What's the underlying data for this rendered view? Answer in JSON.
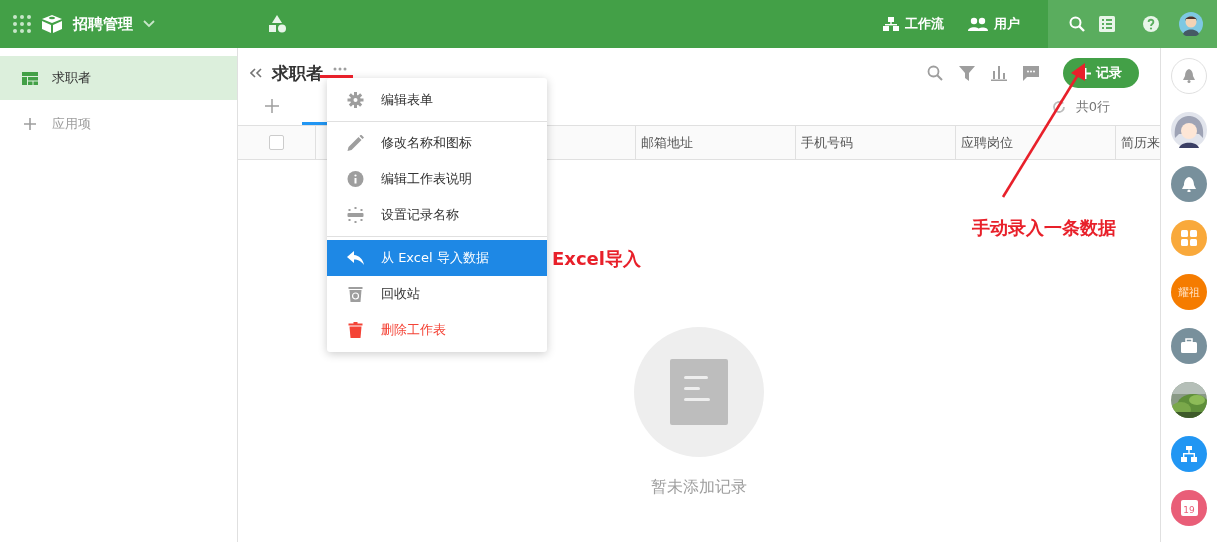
{
  "app": {
    "title": "招聘管理"
  },
  "nav": [
    {
      "label": "工作流",
      "kind": "workflow"
    },
    {
      "label": "用户",
      "kind": "users"
    }
  ],
  "sidebar": {
    "items": [
      {
        "label": "求职者",
        "selected": true
      }
    ],
    "add_label": "应用项"
  },
  "sheet": {
    "title": "求职者",
    "record_button": "记录",
    "row_count": "共0行"
  },
  "table": {
    "select_all": {
      "checked": false
    },
    "columns": [
      "邮箱地址",
      "手机号码",
      "应聘岗位",
      "简历来"
    ]
  },
  "menu": {
    "items": [
      {
        "kind": "item",
        "label": "编辑表单",
        "selected": false,
        "danger": false
      },
      {
        "kind": "divider"
      },
      {
        "kind": "item",
        "label": "修改名称和图标",
        "selected": false,
        "danger": false
      },
      {
        "kind": "item",
        "label": "编辑工作表说明",
        "selected": false,
        "danger": false
      },
      {
        "kind": "item",
        "label": "设置记录名称",
        "selected": false,
        "danger": false
      },
      {
        "kind": "divider"
      },
      {
        "kind": "item",
        "label": "从 Excel 导入数据",
        "selected": true,
        "danger": false
      },
      {
        "kind": "item",
        "label": "回收站",
        "selected": false,
        "danger": false
      },
      {
        "kind": "item",
        "label": "删除工作表",
        "selected": false,
        "danger": true
      }
    ]
  },
  "empty": {
    "text": "暂未添加记录"
  },
  "rail": [
    {
      "kind": "bell-outline"
    },
    {
      "kind": "avatar"
    },
    {
      "kind": "bell",
      "color": "#78909c"
    },
    {
      "kind": "grid",
      "color": "#f9a93b"
    },
    {
      "kind": "text",
      "label": "耀祖",
      "color": "#f57c00"
    },
    {
      "kind": "briefcase",
      "color": "#78909c"
    },
    {
      "kind": "picture"
    },
    {
      "kind": "org",
      "color": "#2196f3"
    },
    {
      "kind": "calendar",
      "label": "19",
      "color": "#e95e78"
    }
  ],
  "annotations": [
    {
      "kind": "underline"
    },
    {
      "kind": "menu-note",
      "text": "Excel导入"
    },
    {
      "kind": "arrow"
    },
    {
      "kind": "button-note",
      "text": "手动录入一条数据"
    }
  ]
}
